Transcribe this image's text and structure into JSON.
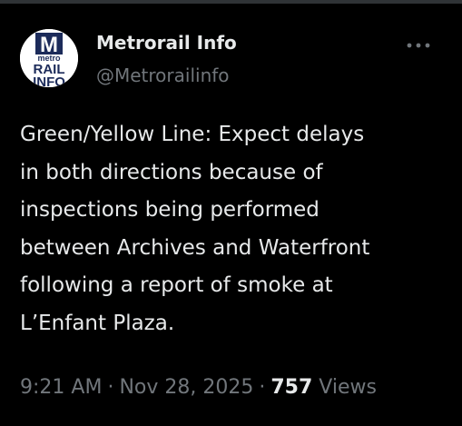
{
  "tweet": {
    "author": {
      "display_name": "Metrorail Info",
      "handle": "@Metrorailinfo",
      "avatar": {
        "icon": "metro-rail-info-logo",
        "logo_text": [
          "M",
          "metro",
          "RAIL",
          "INFO"
        ]
      }
    },
    "more_icon": "more-horizontal-icon",
    "text": "Green/Yellow Line: Expect delays\nin both directions because of\ninspections being performed\nbetween Archives and Waterfront\nfollowing a report of smoke at\nL’Enfant Plaza.",
    "time": "9:21 AM",
    "separator": "·",
    "date": "Nov 28, 2025",
    "views_count": "757",
    "views_label": "Views"
  },
  "colors": {
    "background": "#000000",
    "primary_text": "#e7e9ea",
    "secondary_text": "#71767b",
    "border": "#2f3336",
    "logo_navy": "#1c2b5a"
  }
}
